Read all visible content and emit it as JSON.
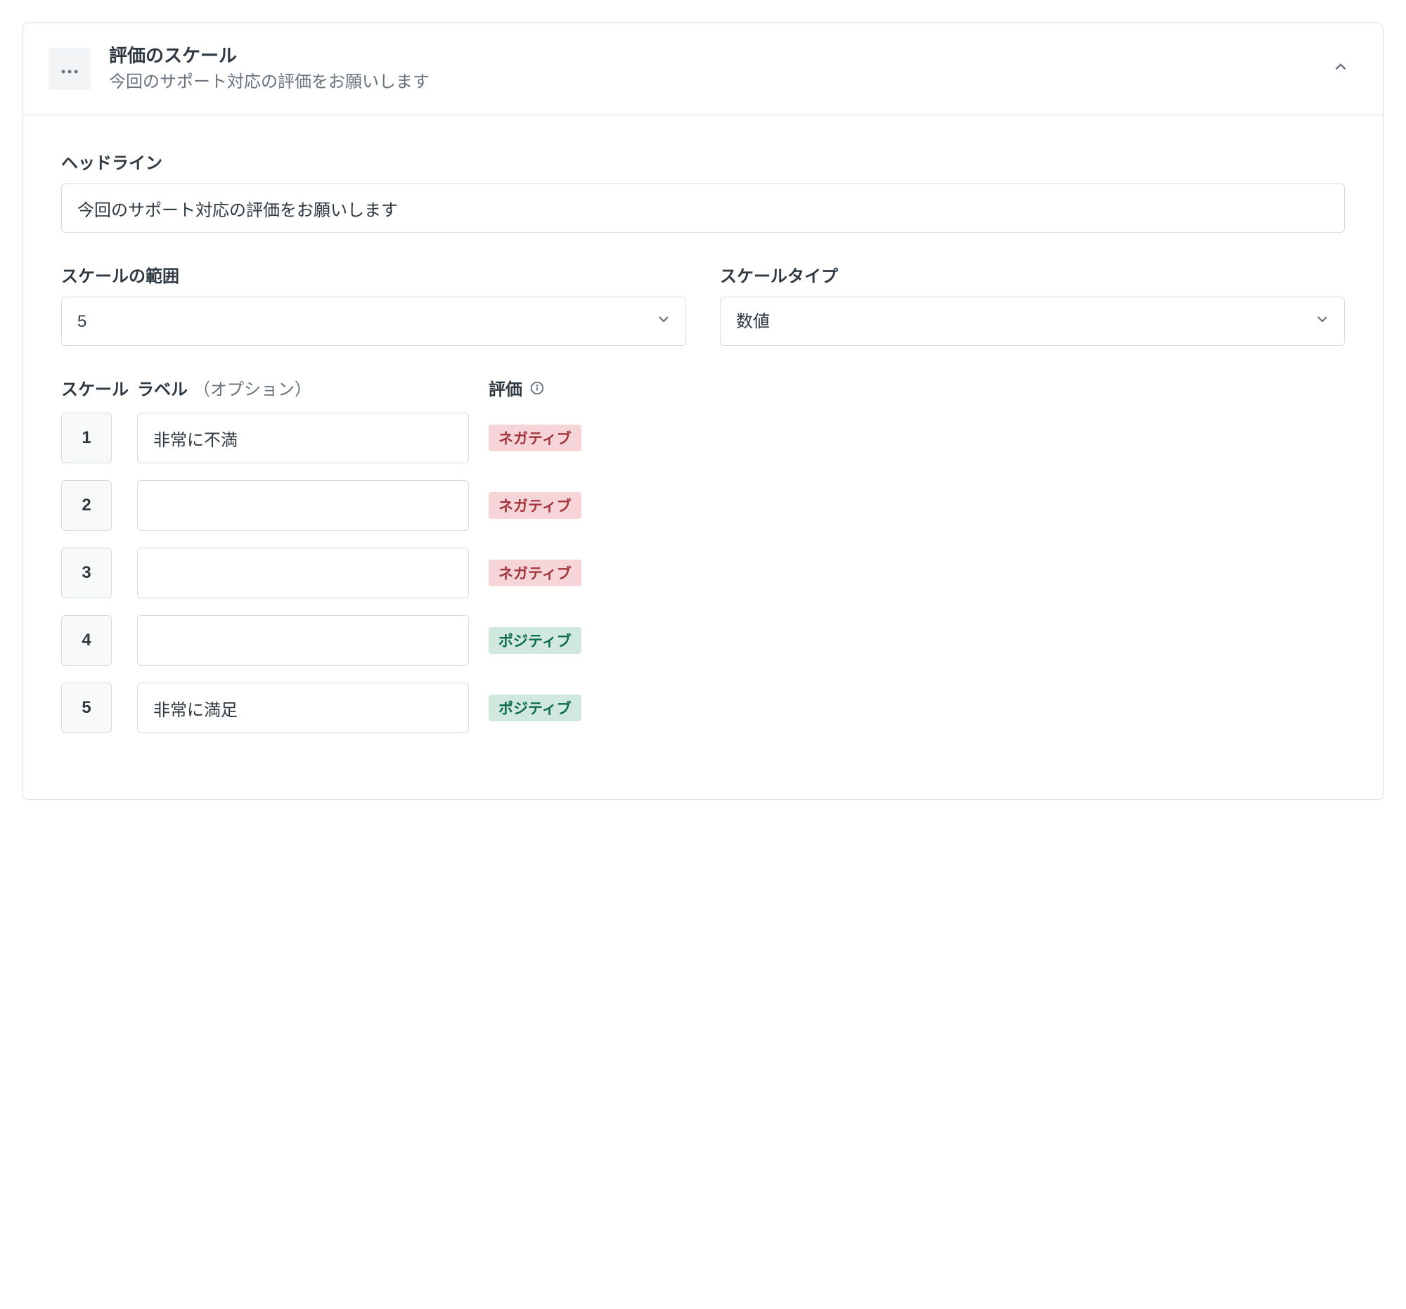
{
  "card": {
    "title": "評価のスケール",
    "subtitle": "今回のサポート対応の評価をお願いします"
  },
  "labels": {
    "headline": "ヘッドライン",
    "scale_range": "スケールの範囲",
    "scale_type": "スケールタイプ",
    "scale_col": "スケール",
    "label_col": "ラベル",
    "label_col_suffix": "（オプション）",
    "rating_col": "評価"
  },
  "fields": {
    "headline_value": "今回のサポート対応の評価をお願いします",
    "scale_range_value": "5",
    "scale_type_value": "数値"
  },
  "badges": {
    "negative": "ネガティブ",
    "positive": "ポジティブ"
  },
  "scale_rows": [
    {
      "number": "1",
      "label": "非常に不満",
      "rating": "negative"
    },
    {
      "number": "2",
      "label": "",
      "rating": "negative"
    },
    {
      "number": "3",
      "label": "",
      "rating": "negative"
    },
    {
      "number": "4",
      "label": "",
      "rating": "positive"
    },
    {
      "number": "5",
      "label": "非常に満足",
      "rating": "positive"
    }
  ]
}
